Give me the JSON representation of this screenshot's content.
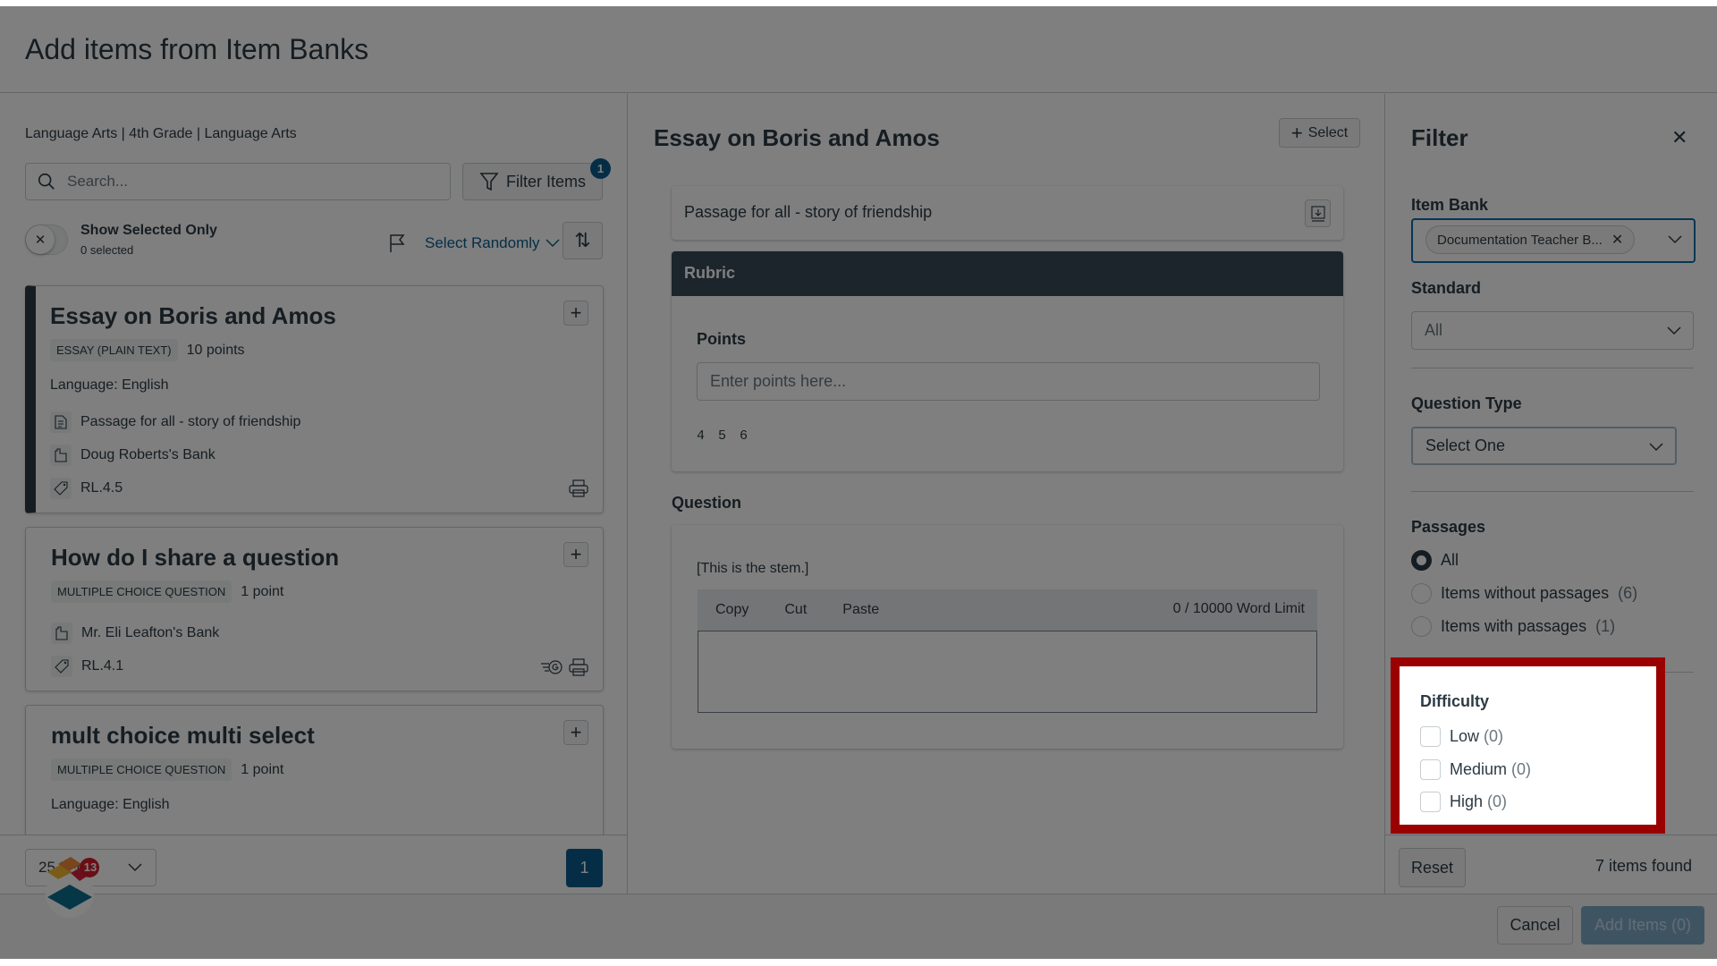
{
  "modal": {
    "title": "Add items from Item Banks"
  },
  "left": {
    "breadcrumb": "Language Arts | 4th Grade | Language Arts",
    "search_placeholder": "Search...",
    "filter_button": "Filter Items",
    "filter_badge": "1",
    "toggle": {
      "label": "Show Selected Only",
      "sub": "0 selected",
      "state": "off"
    },
    "select_randomly": "Select Randomly",
    "items": [
      {
        "title": "Essay on Boris and Amos",
        "type": "ESSAY (PLAIN TEXT)",
        "points": "10 points",
        "language": "Language: English",
        "passage": "Passage for all - story of friendship",
        "bank": "Doug Roberts's Bank",
        "standard": "RL.4.5",
        "active": true
      },
      {
        "title": "How do I share a question",
        "type": "MULTIPLE CHOICE QUESTION",
        "points": "1 point",
        "bank": "Mr. Eli Leafton's Bank",
        "standard": "RL.4.1"
      },
      {
        "title": "mult choice multi select",
        "type": "MULTIPLE CHOICE QUESTION",
        "points": "1 point",
        "language": "Language: English"
      }
    ],
    "per_page": "25 Items",
    "current_page": "1",
    "floating_badge": "13"
  },
  "preview": {
    "title": "Essay on Boris and Amos",
    "select_button": "Select",
    "passage": "Passage for all - story of friendship",
    "rubric": {
      "header": "Rubric",
      "points_label": "Points",
      "points_placeholder": "Enter points here...",
      "values": "4 5 6"
    },
    "question": {
      "label": "Question",
      "stem": "[This is the stem.]",
      "toolbar": [
        "Copy",
        "Cut",
        "Paste"
      ],
      "word_limit": "0 /  10000 Word Limit"
    }
  },
  "filter": {
    "title": "Filter",
    "item_bank": {
      "label": "Item Bank",
      "selected": "Documentation Teacher B..."
    },
    "standard": {
      "label": "Standard",
      "value": "All"
    },
    "question_type": {
      "label": "Question Type",
      "value": "Select One"
    },
    "passages": {
      "label": "Passages",
      "options": [
        {
          "label": "All",
          "count": "",
          "checked": true
        },
        {
          "label": "Items without passages",
          "count": "(6)",
          "checked": false
        },
        {
          "label": "Items with passages",
          "count": "(1)",
          "checked": false
        }
      ]
    },
    "difficulty": {
      "label": "Difficulty",
      "options": [
        {
          "label": "Low",
          "count": "(0)",
          "checked": false
        },
        {
          "label": "Medium",
          "count": "(0)",
          "checked": false
        },
        {
          "label": "High",
          "count": "(0)",
          "checked": false
        }
      ]
    },
    "reset": "Reset",
    "found": "7 items found"
  },
  "footer": {
    "cancel": "Cancel",
    "add": "Add Items (0)"
  },
  "colors": {
    "brand": "#0b5c8c",
    "highlight": "#9b0000",
    "dark_header": "#394b58"
  }
}
